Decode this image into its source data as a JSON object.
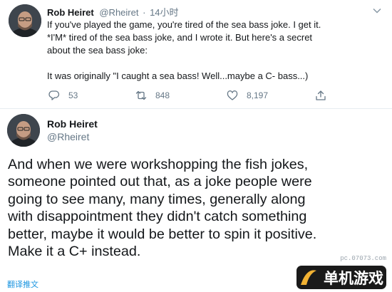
{
  "tweet1": {
    "name": "Rob Heiret",
    "handle": "@Rheiret",
    "separator": "·",
    "time": "14小时",
    "paragraph1": "If you've played the game, you're tired of the sea bass joke. I get it.\n*I'M* tired of the sea bass joke, and I wrote it. But here's a secret\nabout the sea bass joke:",
    "paragraph2": "It was originally \"I caught a sea bass! Well...maybe a C- bass...)",
    "reply_count": "53",
    "retweet_count": "848",
    "like_count": "8,197",
    "icons": [
      "caret-down-icon",
      "reply-icon",
      "retweet-icon",
      "like-icon",
      "share-icon"
    ]
  },
  "tweet2": {
    "name": "Rob Heiret",
    "handle": "@Rheiret",
    "lines": [
      "And when we were workshopping the fish jokes,",
      "someone pointed out that, as a joke people were",
      "going to see many, many times, generally along",
      "with disappointment they didn't catch something",
      "better, maybe it would be better to spin it positive.",
      "Make it a C+ instead."
    ],
    "translate_label": "翻译推文"
  },
  "watermark": {
    "url": "pc.07073.com",
    "logo_text": "单机游戏"
  },
  "colors": {
    "text": "#14171a",
    "secondary": "#657786",
    "link": "#1b95e0",
    "divider": "#e6ecf0"
  }
}
